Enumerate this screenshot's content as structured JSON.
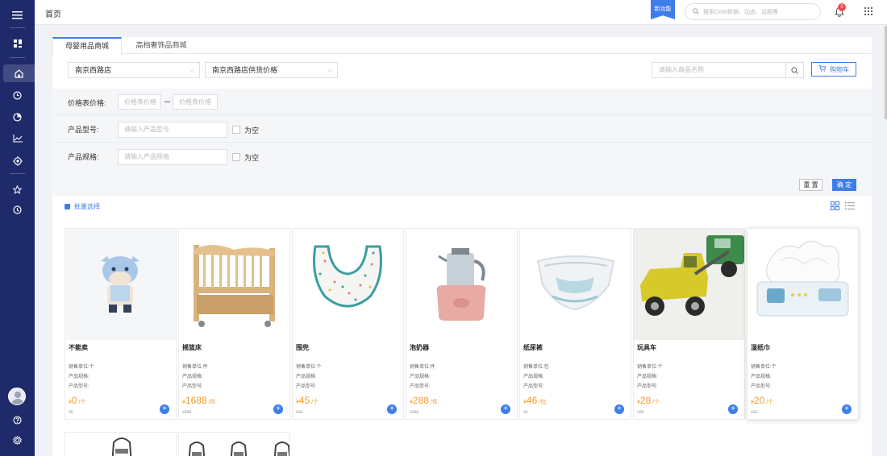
{
  "header": {
    "page_title": "首页",
    "new_feature_label": "新功能",
    "search_placeholder": "搜索CRM数据、动态、话题等",
    "notification_count": "5"
  },
  "tabs": [
    {
      "label": "母婴用品商城",
      "active": true
    },
    {
      "label": "高档奢饰品商城",
      "active": false
    }
  ],
  "toolbar": {
    "store_select": "南京西路店",
    "price_select": "南京西路店供货价格",
    "product_search_placeholder": "请输入商品名称",
    "cart_label": "购物车"
  },
  "filters": {
    "price_label": "价格表价格:",
    "price_min_placeholder": "价格表价格",
    "price_max_placeholder": "价格表价格",
    "model_label": "产品型号:",
    "model_placeholder": "请输入产品型号",
    "model_empty_label": "为空",
    "spec_label": "产品规格:",
    "spec_placeholder": "请输入产品规格",
    "spec_empty_label": "为空",
    "reset_label": "重 置",
    "confirm_label": "确 定"
  },
  "batch_select_label": "批量选择",
  "attr_labels": {
    "sales_unit": "销售单位:",
    "spec": "产品规格:",
    "model": "产品型号:"
  },
  "products": [
    {
      "name": "不能卖",
      "unit": "个",
      "price": "0",
      "orig": "¥0",
      "icon": "cow-mascot"
    },
    {
      "name": "摇篮床",
      "unit": "件",
      "price": "1688",
      "orig": "¥888",
      "icon": "crib"
    },
    {
      "name": "围兜",
      "unit": "个",
      "price": "45",
      "orig": "¥15",
      "icon": "bib"
    },
    {
      "name": "泡奶器",
      "unit": "件",
      "price": "288",
      "orig": "¥288",
      "icon": "kettle"
    },
    {
      "name": "纸尿裤",
      "unit": "包",
      "price": "46",
      "orig": "¥0",
      "icon": "diaper"
    },
    {
      "name": "玩具车",
      "unit": "个",
      "price": "28",
      "orig": "¥20",
      "icon": "toy-truck"
    },
    {
      "name": "湿纸巾",
      "unit": "个",
      "price": "20",
      "orig": "¥10",
      "icon": "wipes"
    }
  ],
  "currency_symbol": "¥",
  "colors": {
    "sidebar": "#1f2a6b",
    "accent": "#3d7eea",
    "price": "#f39c28",
    "badge": "#ef4b4b"
  }
}
